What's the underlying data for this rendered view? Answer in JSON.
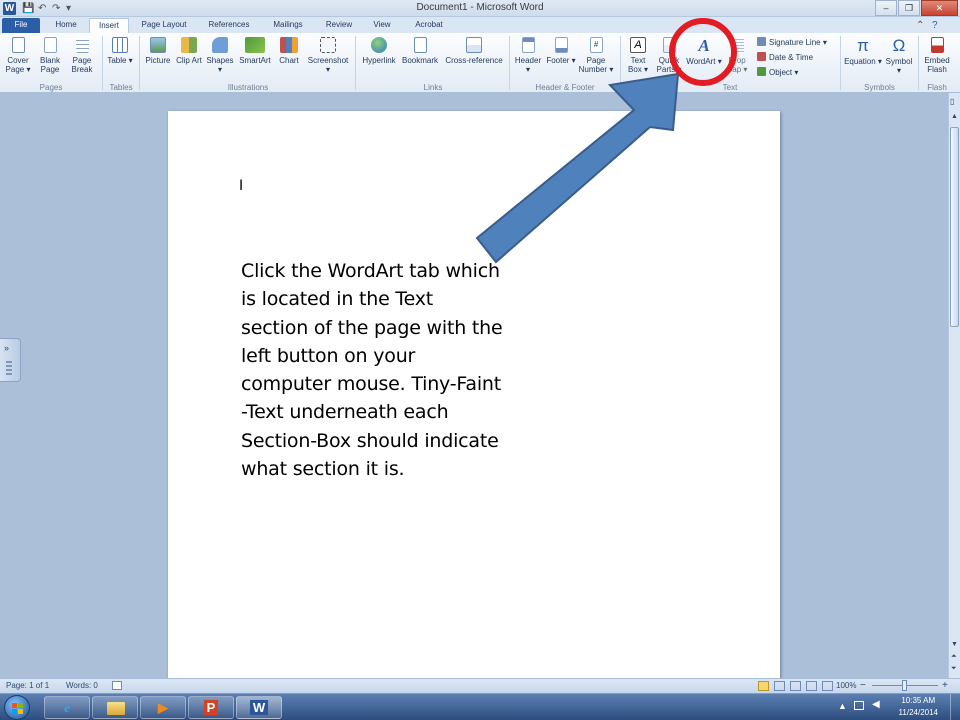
{
  "app": {
    "title": "Document1 - Microsoft Word",
    "icon_letter": "W"
  },
  "window_controls": {
    "minimize": "–",
    "restore": "❐",
    "close": "✕"
  },
  "tabs": [
    "File",
    "Home",
    "Insert",
    "Page Layout",
    "References",
    "Mailings",
    "Review",
    "View",
    "Acrobat"
  ],
  "active_tab": "Insert",
  "ribbon": {
    "groups": {
      "pages": "Pages",
      "tables": "Tables",
      "illustrations": "Illustrations",
      "links": "Links",
      "header_footer": "Header & Footer",
      "text": "Text",
      "symbols": "Symbols",
      "flash": "Flash"
    },
    "buttons": {
      "cover_page": "Cover Page ▾",
      "blank_page": "Blank Page",
      "page_break": "Page Break",
      "table": "Table ▾",
      "picture": "Picture",
      "clip_art": "Clip Art",
      "shapes": "Shapes ▾",
      "smartart": "SmartArt",
      "chart": "Chart",
      "screenshot": "Screenshot ▾",
      "hyperlink": "Hyperlink",
      "bookmark": "Bookmark",
      "cross_reference": "Cross-reference",
      "header": "Header ▾",
      "footer": "Footer ▾",
      "page_number": "Page Number ▾",
      "text_box": "Text Box ▾",
      "quick_parts": "Quick Parts ▾",
      "wordart": "WordArt ▾",
      "drop_cap": "Drop Cap ▾",
      "signature_line": "Signature Line ▾",
      "date_time": "Date & Time",
      "object": "Object ▾",
      "equation": "Equation ▾",
      "symbol": "Symbol ▾",
      "embed_flash": "Embed Flash"
    },
    "glyphs": {
      "text_box": "A",
      "wordart": "A",
      "equation": "π",
      "symbol": "Ω"
    }
  },
  "document": {
    "cursor": "I",
    "instruction": "Click the WordArt tab which is located in the Text section of the page with the left button on your computer mouse. Tiny-Faint -Text underneath each Section-Box should indicate what section it is."
  },
  "status": {
    "page": "Page: 1 of 1",
    "words": "Words: 0",
    "zoom": "100%"
  },
  "clock": {
    "time": "10:35 AM",
    "date": "11/24/2014"
  },
  "taskbar": {
    "word_glyph": "W",
    "ppt_glyph": "P"
  },
  "colors": {
    "annotation_arrow": "#4f81bd",
    "annotation_circle": "#e31b23",
    "file_tab": "#2c5ea8"
  }
}
